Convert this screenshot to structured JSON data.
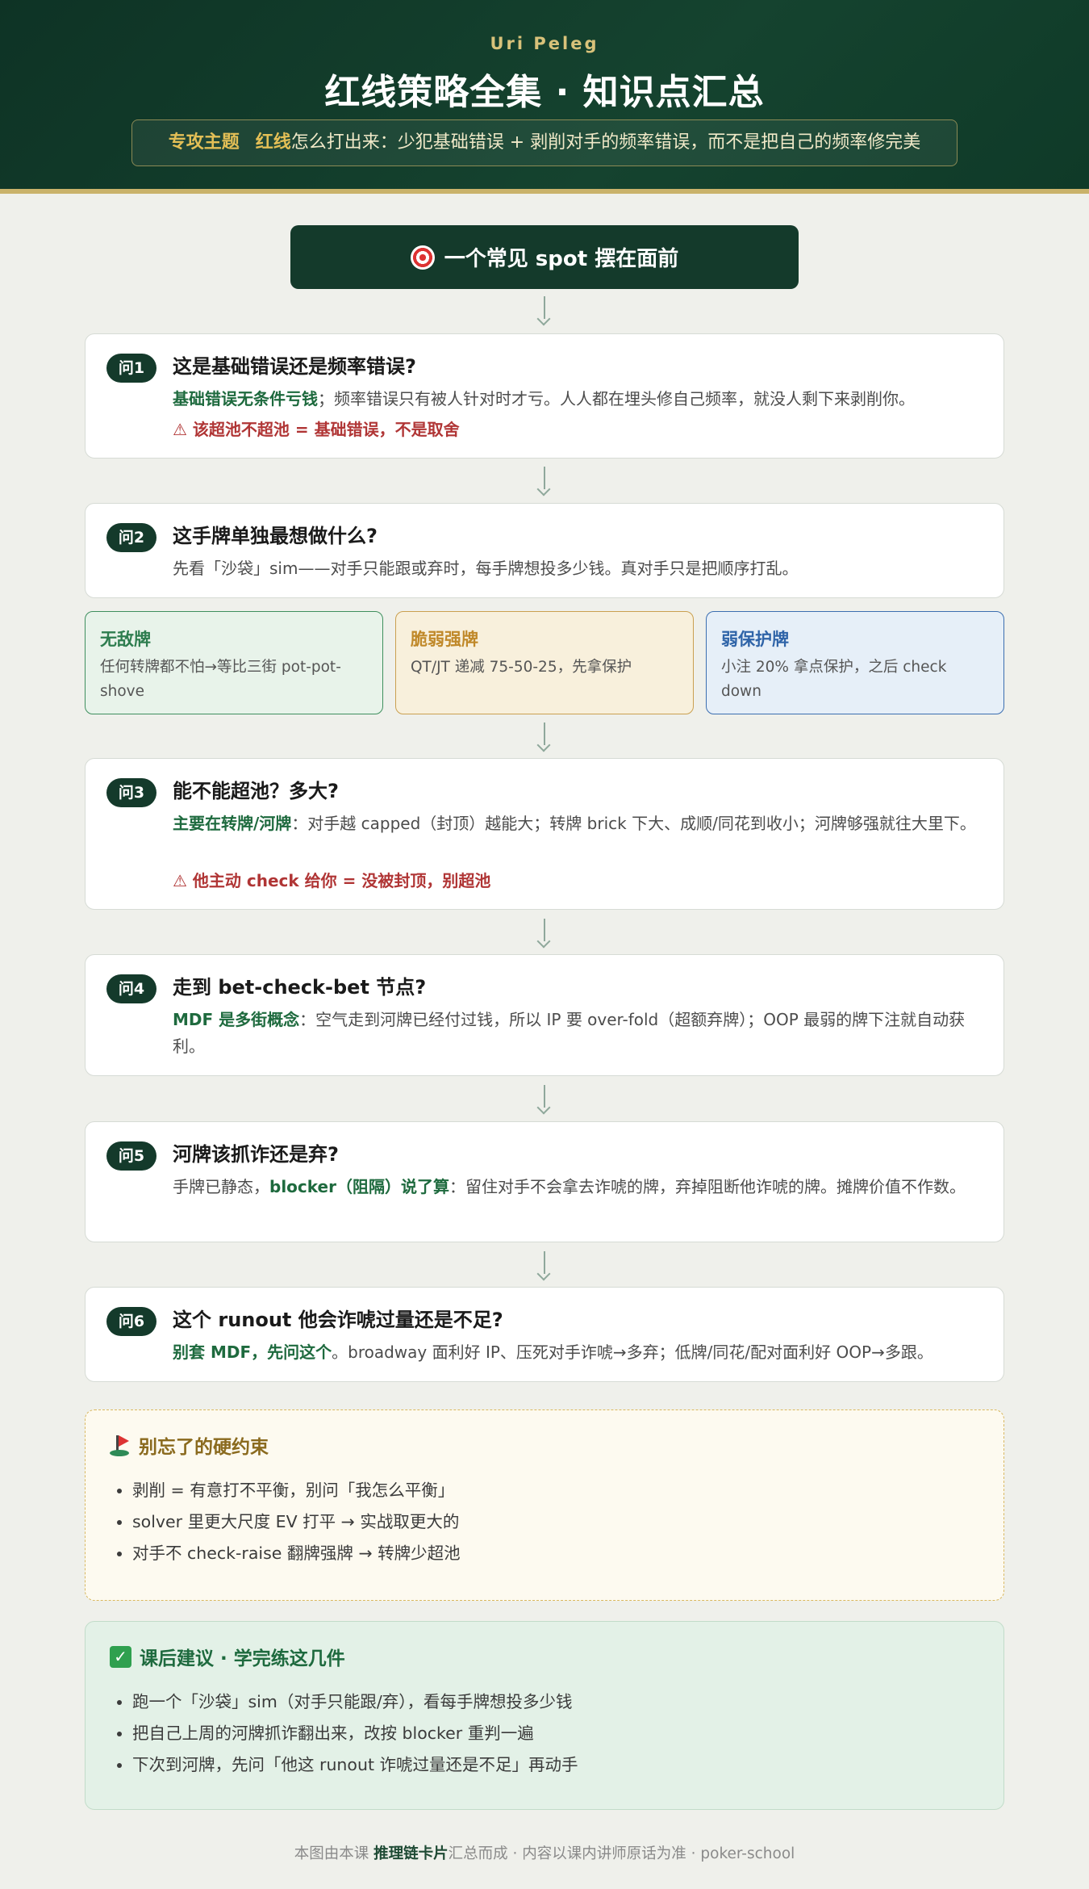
{
  "header": {
    "author": "Uri Peleg",
    "title": "红线策略全集 · 知识点汇总",
    "topic_tag": "专攻主题",
    "topic_highlight": "红线",
    "topic_text": "怎么打出来：少犯基础错误 + 剥削对手的频率错误，而不是把自己的频率修完美"
  },
  "hero": {
    "icon": "target-icon",
    "label": "一个常见 spot 摆在面前"
  },
  "questions": [
    {
      "pill": "问1",
      "title": "这是基础错误还是频率错误?",
      "lead": "基础错误无条件亏钱",
      "body": "；频率错误只有被人针对时才亏。人人都在埋头修自己频率，就没人剩下来剥削你。",
      "warning": "⚠ 该超池不超池 = 基础错误，不是取舍"
    },
    {
      "pill": "问2",
      "title": "这手牌单独最想做什么?",
      "body": "先看「沙袋」sim——对手只能跟或弃时，每手牌想投多少钱。真对手只是把顺序打乱。"
    },
    {
      "pill": "问3",
      "title": "能不能超池？多大?",
      "lead": "主要在转牌/河牌",
      "body": "：对手越 capped（封顶）越能大；转牌 brick 下大、成顺/同花到收小；河牌够强就往大里下。",
      "warning": "⚠ 他主动 check 给你 = 没被封顶，别超池"
    },
    {
      "pill": "问4",
      "title": "走到 bet-check-bet 节点?",
      "lead": "MDF 是多街概念",
      "body": "：空气走到河牌已经付过钱，所以 IP 要 over-fold（超额弃牌）；OOP 最弱的牌下注就自动获利。"
    },
    {
      "pill": "问5",
      "title": "河牌该抓诈还是弃?",
      "pre": "手牌已静态，",
      "lead": "blocker（阻隔）说了算",
      "body": "：留住对手不会拿去诈唬的牌，弃掉阻断他诈唬的牌。摊牌价值不作数。"
    },
    {
      "pill": "问6",
      "title": "这个 runout 他会诈唬过量还是不足?",
      "lead": "别套 MDF，先问这个",
      "body": "。broadway 面利好 IP、压死对手诈唬→多弃；低牌/同花/配对面利好 OOP→多跟。"
    }
  ],
  "categories": [
    {
      "title": "无敌牌",
      "body": "任何转牌都不怕→等比三街 pot-pot-shove",
      "color": "#2e7d4f"
    },
    {
      "title": "脆弱强牌",
      "body": "QT/JT 递减 75-50-25，先拿保护",
      "color": "#c0892a"
    },
    {
      "title": "弱保护牌",
      "body": "小注 20% 拿点保护，之后 check down",
      "color": "#2f64a8"
    }
  ],
  "constraints": {
    "icon": "flag-icon",
    "title": "别忘了的硬约束",
    "items": [
      "剥削 = 有意打不平衡，别问「我怎么平衡」",
      "solver 里更大尺度 EV 打平 → 实战取更大的",
      "对手不 check-raise 翻牌强牌 → 转牌少超池"
    ]
  },
  "advice": {
    "icon": "check-icon",
    "title": "课后建议 · 学完练这几件",
    "items": [
      "跑一个「沙袋」sim（对手只能跟/弃），看每手牌想投多少钱",
      "把自己上周的河牌抓诈翻出来，改按 blocker 重判一遍",
      "下次到河牌，先问「他这 runout 诈唬过量还是不足」再动手"
    ]
  },
  "footer": {
    "pre": "本图由本课 ",
    "bold": "推理链卡片",
    "post": "汇总而成 · 内容以课内讲师原话为准 · poker-school"
  }
}
